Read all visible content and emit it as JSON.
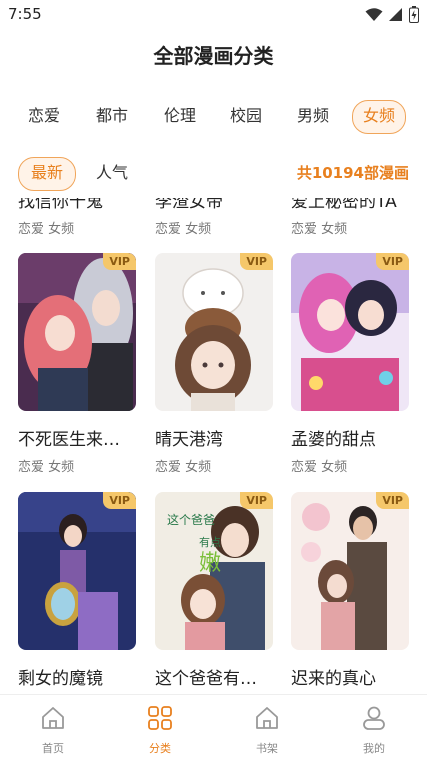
{
  "status_bar": {
    "time": "7:55"
  },
  "header": {
    "title": "全部漫画分类"
  },
  "category_tabs": [
    {
      "label": "恋爱"
    },
    {
      "label": "都市"
    },
    {
      "label": "伦理"
    },
    {
      "label": "校园"
    },
    {
      "label": "男频"
    },
    {
      "label": "女频",
      "active": true
    }
  ],
  "sort_tabs": [
    {
      "label": "最新",
      "active": true
    },
    {
      "label": "人气"
    }
  ],
  "total_count": "共10194部漫画",
  "comics_partial": [
    {
      "title": "找信你十鬼",
      "tags": "恋爱 女频"
    },
    {
      "title": "李渣女帝",
      "tags": "恋爱 女频"
    },
    {
      "title": "爱上秘密的TA",
      "tags": "恋爱 女频"
    }
  ],
  "comics": [
    {
      "title": "不死医生来…",
      "tags": "恋爱 女频",
      "badge": "VIP"
    },
    {
      "title": "晴天港湾",
      "tags": "恋爱 女频",
      "badge": "VIP"
    },
    {
      "title": "孟婆的甜点",
      "tags": "恋爱 女频",
      "badge": "VIP"
    },
    {
      "title": "剩女的魔镜",
      "tags": "",
      "badge": "VIP"
    },
    {
      "title": "这个爸爸有…",
      "tags": "",
      "badge": "VIP",
      "cover_text_1": "这个爸爸",
      "cover_text_2": "有点",
      "cover_text_3": "嫩"
    },
    {
      "title": "迟来的真心",
      "tags": "",
      "badge": "VIP"
    }
  ],
  "bottom_nav": [
    {
      "label": "首页",
      "icon": "home-icon"
    },
    {
      "label": "分类",
      "icon": "category-icon",
      "active": true
    },
    {
      "label": "书架",
      "icon": "bookshelf-icon"
    },
    {
      "label": "我的",
      "icon": "profile-icon"
    }
  ],
  "colors": {
    "accent": "#e8801f",
    "accent_bg": "#fff3e8",
    "vip": "#f5c76a"
  }
}
